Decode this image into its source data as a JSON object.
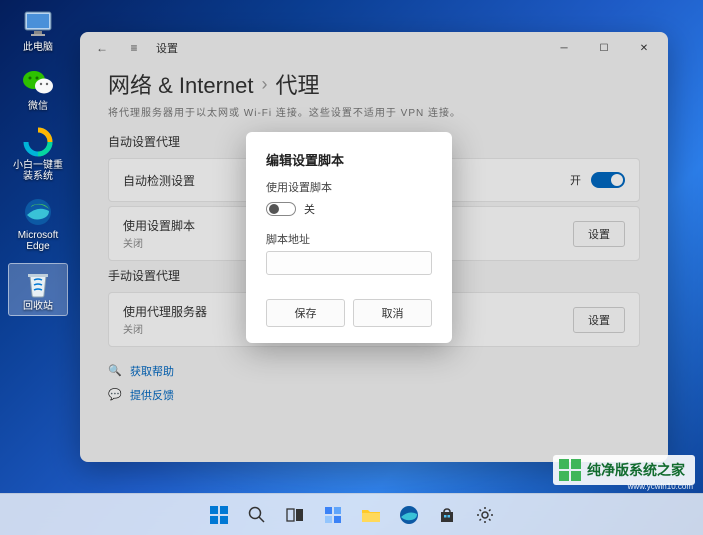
{
  "desktop": {
    "icons": [
      {
        "name": "computer-icon",
        "label": "此电脑"
      },
      {
        "name": "wechat-icon",
        "label": "微信"
      },
      {
        "name": "reinstall-icon",
        "label": "小白一键重装系统"
      },
      {
        "name": "edge-icon",
        "label": "Microsoft Edge"
      },
      {
        "name": "recycle-bin-icon",
        "label": "回收站"
      }
    ]
  },
  "window": {
    "app_title": "设置",
    "breadcrumb": {
      "root": "网络 & Internet",
      "current": "代理"
    },
    "subtitle": "将代理服务器用于以太网或 Wi-Fi 连接。这些设置不适用于 VPN 连接。",
    "sections": {
      "auto": {
        "title": "自动设置代理",
        "row1": {
          "label": "自动检测设置",
          "toggle_label": "开"
        },
        "row2": {
          "label": "使用设置脚本",
          "sub": "关闭",
          "button": "设置"
        }
      },
      "manual": {
        "title": "手动设置代理",
        "row1": {
          "label": "使用代理服务器",
          "sub": "关闭",
          "button": "设置"
        }
      }
    },
    "help": {
      "get_help": "获取帮助",
      "feedback": "提供反馈"
    }
  },
  "modal": {
    "title": "编辑设置脚本",
    "use_script_label": "使用设置脚本",
    "toggle_state": "关",
    "address_label": "脚本地址",
    "address_value": "",
    "save": "保存",
    "cancel": "取消"
  },
  "watermark": {
    "text": "纯净版系统之家",
    "url": "www.ycwin10.com"
  }
}
